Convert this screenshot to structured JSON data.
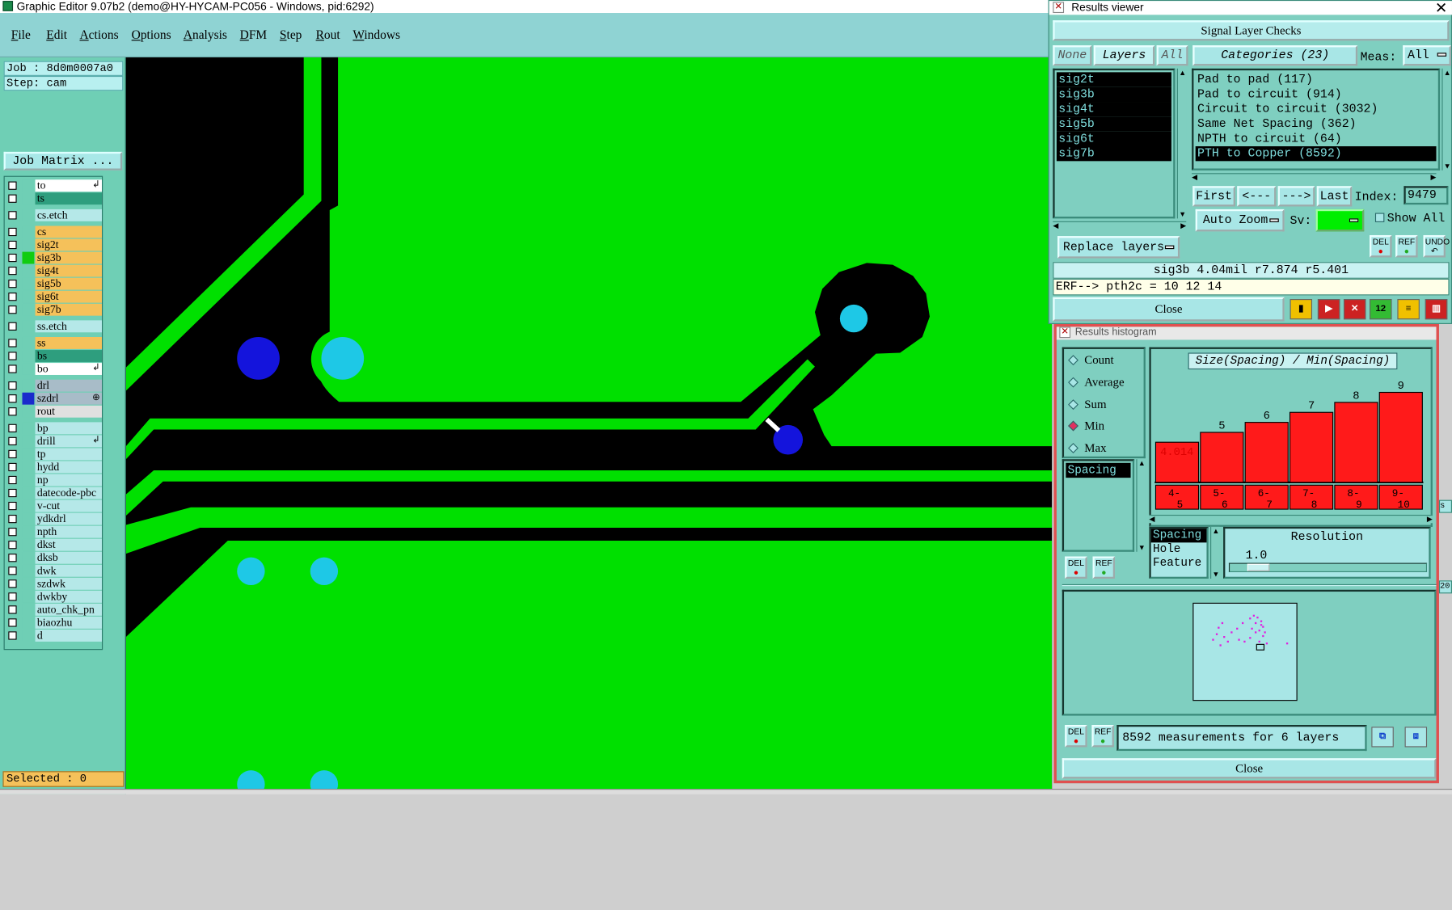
{
  "main_window": {
    "title": "Graphic Editor 9.07b2 (demo@HY-HYCAM-PC056 - Windows, pid:6292)",
    "menus": [
      "File",
      "Edit",
      "Actions",
      "Options",
      "Analysis",
      "DFM",
      "Step",
      "Rout",
      "Windows"
    ]
  },
  "left_panel": {
    "job_line": "Job : 8d0m0007a0",
    "step_line": "Step: cam",
    "job_matrix_button": "Job Matrix ...",
    "layers": [
      {
        "name": "to",
        "color": "#ffffff",
        "swatch": "#000000",
        "flag": "↲"
      },
      {
        "name": "ts",
        "color": "#2e9e7e",
        "swatch": "#000000",
        "flag": ""
      },
      {
        "name": "cs.etch",
        "color": "#b5e8e8",
        "swatch": "#000000",
        "flag": ""
      },
      {
        "name": "cs",
        "color": "#f5c15a",
        "swatch": "#000000",
        "flag": ""
      },
      {
        "name": "sig2t",
        "color": "#f5c15a",
        "swatch": "#000000",
        "flag": ""
      },
      {
        "name": "sig3b",
        "color": "#f5c15a",
        "swatch": "#11cc11",
        "flag": ""
      },
      {
        "name": "sig4t",
        "color": "#f5c15a",
        "swatch": "#000000",
        "flag": ""
      },
      {
        "name": "sig5b",
        "color": "#f5c15a",
        "swatch": "#000000",
        "flag": ""
      },
      {
        "name": "sig6t",
        "color": "#f5c15a",
        "swatch": "#000000",
        "flag": ""
      },
      {
        "name": "sig7b",
        "color": "#f5c15a",
        "swatch": "#000000",
        "flag": ""
      },
      {
        "name": "ss.etch",
        "color": "#b5e8e8",
        "swatch": "#000000",
        "flag": ""
      },
      {
        "name": "ss",
        "color": "#f5c15a",
        "swatch": "#000000",
        "flag": ""
      },
      {
        "name": "bs",
        "color": "#2e9e7e",
        "swatch": "#000000",
        "flag": ""
      },
      {
        "name": "bo",
        "color": "#ffffff",
        "swatch": "#000000",
        "flag": "↲"
      },
      {
        "name": "drl",
        "color": "#a8bcc8",
        "swatch": "#000000",
        "flag": ""
      },
      {
        "name": "szdrl",
        "color": "#a8bcc8",
        "swatch": "#1a2acc",
        "flag": "⊕"
      },
      {
        "name": "rout",
        "color": "#e0e0e0",
        "swatch": "#000000",
        "flag": ""
      },
      {
        "name": "bp",
        "color": "#b5e8e8",
        "swatch": "#000000",
        "flag": ""
      },
      {
        "name": "drill",
        "color": "#b5e8e8",
        "swatch": "#000000",
        "flag": "↲"
      },
      {
        "name": "tp",
        "color": "#b5e8e8",
        "swatch": "#000000",
        "flag": ""
      },
      {
        "name": "hydd",
        "color": "#b5e8e8",
        "swatch": "#000000",
        "flag": ""
      },
      {
        "name": "np",
        "color": "#b5e8e8",
        "swatch": "#000000",
        "flag": ""
      },
      {
        "name": "datecode-pbc",
        "color": "#b5e8e8",
        "swatch": "#000000",
        "flag": ""
      },
      {
        "name": "v-cut",
        "color": "#b5e8e8",
        "swatch": "#000000",
        "flag": ""
      },
      {
        "name": "ydkdrl",
        "color": "#b5e8e8",
        "swatch": "#000000",
        "flag": ""
      },
      {
        "name": "npth",
        "color": "#b5e8e8",
        "swatch": "#000000",
        "flag": ""
      },
      {
        "name": "dkst",
        "color": "#b5e8e8",
        "swatch": "#000000",
        "flag": ""
      },
      {
        "name": "dksb",
        "color": "#b5e8e8",
        "swatch": "#000000",
        "flag": ""
      },
      {
        "name": "dwk",
        "color": "#b5e8e8",
        "swatch": "#000000",
        "flag": ""
      },
      {
        "name": "szdwk",
        "color": "#b5e8e8",
        "swatch": "#000000",
        "flag": ""
      },
      {
        "name": "dwkby",
        "color": "#b5e8e8",
        "swatch": "#000000",
        "flag": ""
      },
      {
        "name": "auto_chk_pn",
        "color": "#b5e8e8",
        "swatch": "#000000",
        "flag": ""
      },
      {
        "name": "biaozhu",
        "color": "#b5e8e8",
        "swatch": "#000000",
        "flag": ""
      },
      {
        "name": "d",
        "color": "#b5e8e8",
        "swatch": "#000000",
        "flag": ""
      }
    ],
    "selected_line": "Selected : 0"
  },
  "results_viewer": {
    "title": "Results viewer",
    "header": "Signal Layer Checks",
    "none_btn": "None",
    "layers_btn": "Layers",
    "all_btn": "All",
    "categories_btn": "Categories (23)",
    "meas_label": "Meas:",
    "meas_value": "All",
    "layer_items": [
      "sig2t",
      "sig3b",
      "sig4t",
      "sig5b",
      "sig6t",
      "sig7b"
    ],
    "categories": [
      {
        "label": "Pad to pad (117)",
        "selected": false
      },
      {
        "label": "Pad to circuit (914)",
        "selected": false
      },
      {
        "label": "Circuit to circuit (3032)",
        "selected": false
      },
      {
        "label": "Same Net Spacing (362)",
        "selected": false
      },
      {
        "label": "NPTH to circuit (64)",
        "selected": false
      },
      {
        "label": "PTH to Copper (8592)",
        "selected": true
      }
    ],
    "first_btn": "First",
    "prev_btn": "<---",
    "next_btn": "--->",
    "last_btn": "Last",
    "index_label": "Index:",
    "index_value": "9479",
    "auto_zoom": "Auto Zoom",
    "sv_label": "Sv:",
    "show_all": "Show All",
    "replace_layers": "Replace layers",
    "del_label": "DEL",
    "ref_label": "REF",
    "undo_label": "UNDO",
    "status_measure": "sig3b 4.04mil  r7.874  r5.401",
    "status_erf": "ERF--> pth2c = 10 12 14",
    "close_btn": "Close"
  },
  "results_histogram": {
    "title": "Results histogram",
    "stat_options": [
      {
        "label": "Count",
        "on": false
      },
      {
        "label": "Average",
        "on": false
      },
      {
        "label": "Sum",
        "on": false
      },
      {
        "label": "Min",
        "on": true
      },
      {
        "label": "Max",
        "on": false
      }
    ],
    "attribute_item": "Spacing",
    "del_label": "DEL",
    "ref_label": "REF",
    "hist_title": "Size(Spacing) / Min(Spacing)",
    "resolution_label": "Resolution",
    "resolution_value": "1.0",
    "resolution_fraction": 0.1,
    "attr_list": [
      "Spacing",
      "Hole",
      "Feature"
    ],
    "measurements_text": "8592 measurements for 6 layers",
    "close_btn": "Close"
  },
  "chart_data": {
    "type": "bar",
    "title": "Size(Spacing) / Min(Spacing)",
    "categories": [
      "4-5",
      "5-6",
      "6-7",
      "7-8",
      "8-9",
      "9-10"
    ],
    "values": [
      4.014,
      5,
      6,
      7,
      8,
      9
    ],
    "value_labels": [
      "4.014",
      "5",
      "6",
      "7",
      "8",
      "9"
    ],
    "bar_color": "#ff1a1a",
    "ylim": [
      0,
      10
    ]
  },
  "colors": {
    "copper": "#00e000",
    "drill_dark": "#1414dc",
    "drill_light": "#1ec8e6",
    "panel": "#7fcfc0"
  },
  "side_clips": [
    "s",
    "20"
  ]
}
